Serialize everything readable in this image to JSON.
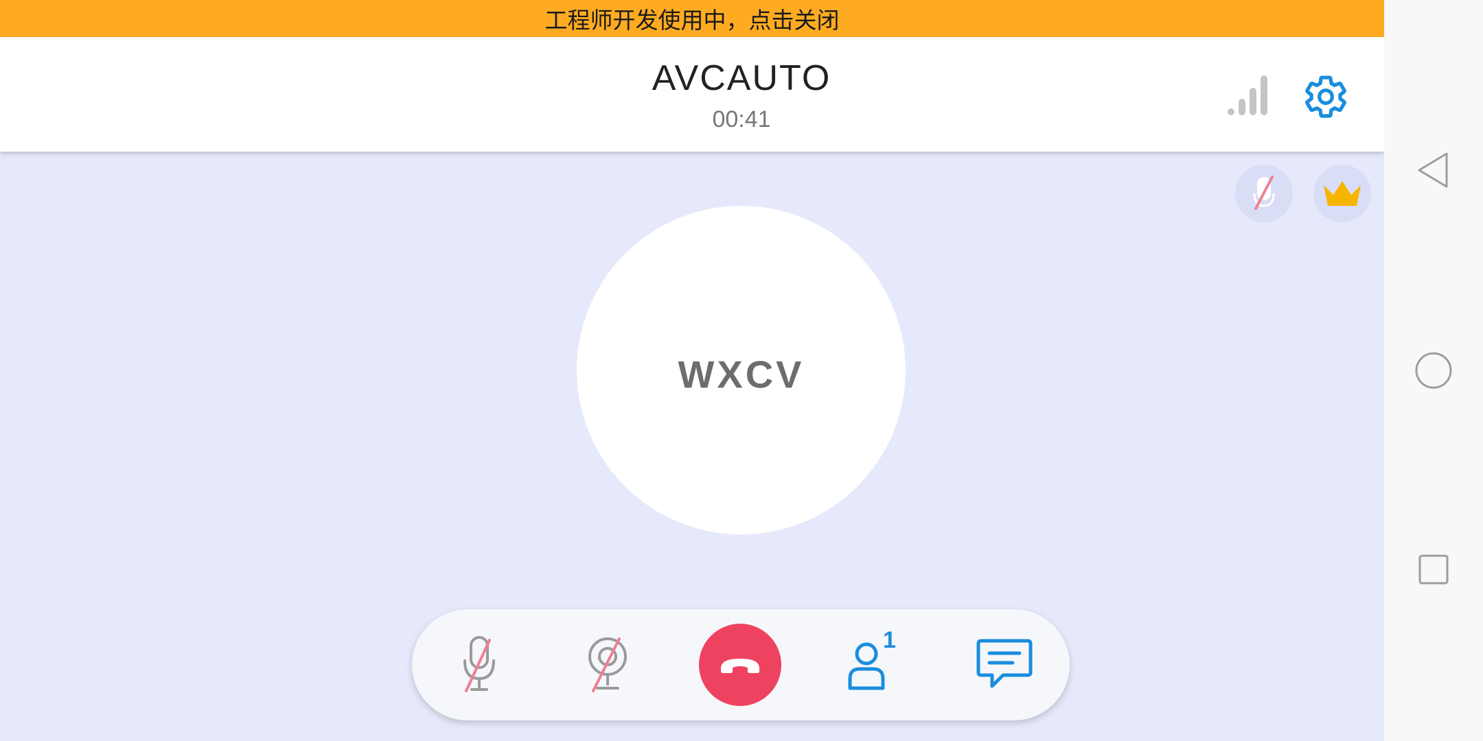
{
  "banner": {
    "text": "工程师开发使用中，点击关闭"
  },
  "header": {
    "title": "AVCAUTO",
    "timer": "00:41"
  },
  "participant": {
    "name": "WXCV"
  },
  "controls": {
    "participants_count": "1"
  },
  "icons": {
    "signal": "signal-strength-icon",
    "settings": "gear-icon",
    "mic_badge": "muted-mic-icon",
    "host_badge": "crown-icon",
    "mic": "muted-mic-icon",
    "camera": "camera-off-icon",
    "hangup": "phone-hangup-icon",
    "participants": "person-icon",
    "chat": "chat-bubble-icon",
    "nav_back": "back-triangle-icon",
    "nav_home": "home-circle-icon",
    "nav_recent": "recents-square-icon"
  },
  "colors": {
    "banner": "#ffab21",
    "accent": "#1a8ddd",
    "hangup": "#ee4360",
    "stage": "#e6e9fb",
    "crown": "#f7b500",
    "muted_slash": "#ef7f93"
  }
}
